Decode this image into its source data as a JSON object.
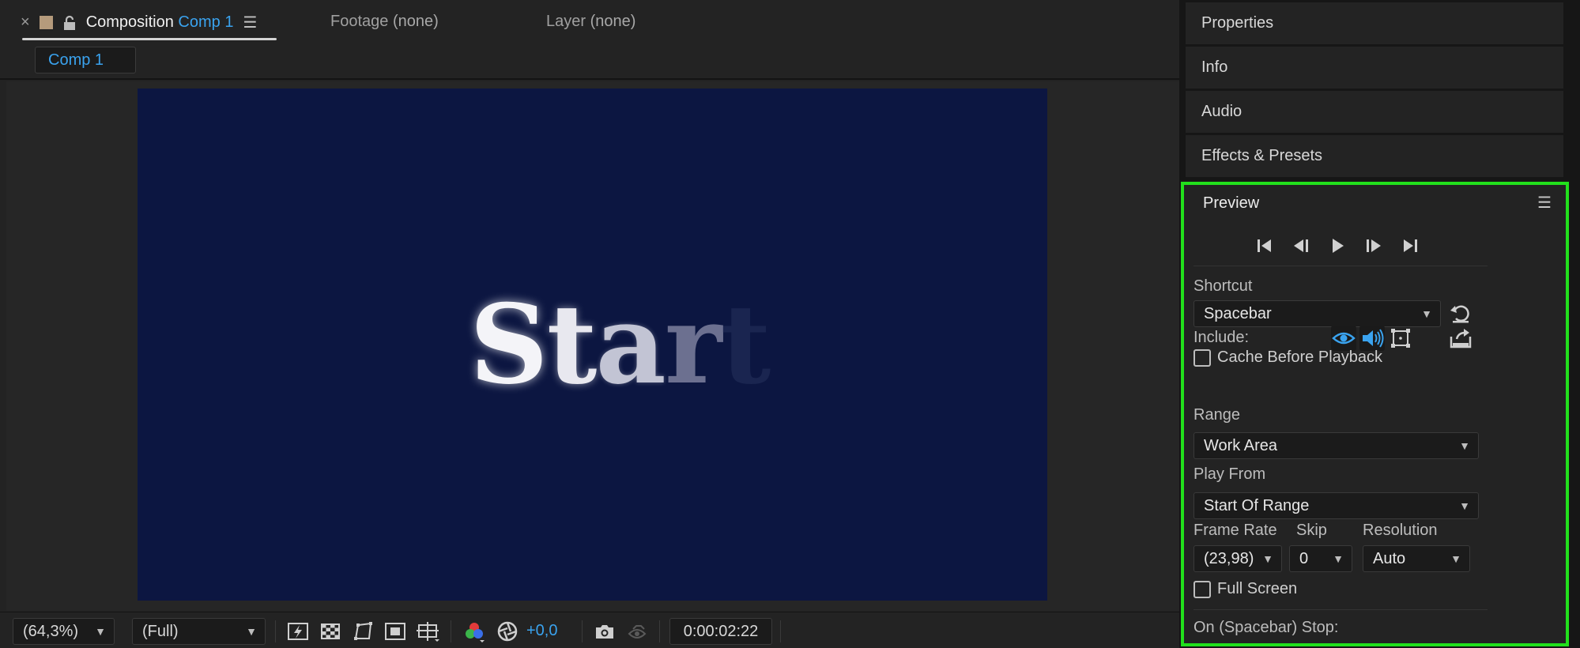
{
  "composition_panel": {
    "tabs": {
      "composition": {
        "close": "×",
        "label": "Composition",
        "comp_name": "Comp 1",
        "menu": "☰"
      },
      "footage": {
        "label": "Footage",
        "value": "(none)"
      },
      "layer": {
        "label": "Layer",
        "value": "(none)"
      }
    },
    "breadcrumb": "Comp 1",
    "canvas_text": [
      "S",
      "t",
      "a",
      "r",
      "t"
    ],
    "toolbar": {
      "zoom": "(64,3%)",
      "resolution": "(Full)",
      "exposure": "+0,0",
      "timecode": "0:00:02:22"
    }
  },
  "side_panels": {
    "properties": "Properties",
    "info": "Info",
    "audio": "Audio",
    "effects": "Effects & Presets"
  },
  "preview": {
    "title": "Preview",
    "menu": "☰",
    "shortcut_label": "Shortcut",
    "shortcut_value": "Spacebar",
    "include_label": "Include:",
    "cache_label": "Cache Before Playback",
    "range_label": "Range",
    "range_value": "Work Area",
    "play_from_label": "Play From",
    "play_from_value": "Start Of Range",
    "frame_rate_label": "Frame Rate",
    "frame_rate_value": "(23,98)",
    "skip_label": "Skip",
    "skip_value": "0",
    "resolution_label": "Resolution",
    "resolution_value": "Auto",
    "full_screen_label": "Full Screen",
    "stop_label": "On (Spacebar) Stop:"
  },
  "colors": {
    "accent": "#3aa3ef",
    "highlight_border": "#22e01c",
    "canvas_bg": "#0c1641"
  }
}
